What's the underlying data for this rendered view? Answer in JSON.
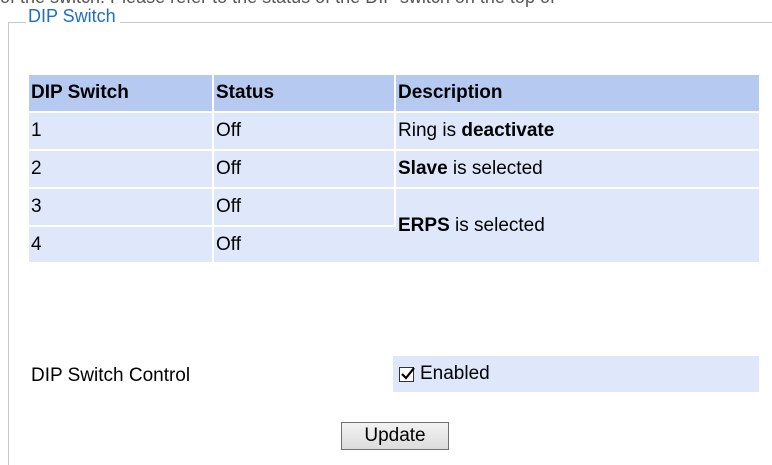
{
  "top_clipped_text": "of the switch. Please refer to the status of the DIP switch on the top of",
  "panel": {
    "legend": "DIP Switch"
  },
  "table": {
    "headers": {
      "dip_switch": "DIP Switch",
      "status": "Status",
      "description": "Description"
    },
    "rows": [
      {
        "dip": "1",
        "status": "Off"
      },
      {
        "dip": "2",
        "status": "Off"
      },
      {
        "dip": "3",
        "status": "Off"
      },
      {
        "dip": "4",
        "status": "Off"
      }
    ],
    "descriptions": {
      "ring_prefix": "Ring is ",
      "ring_bold": "deactivate",
      "slave_bold": "Slave",
      "slave_suffix": " is selected",
      "erps_bold": "ERPS",
      "erps_suffix": " is selected"
    }
  },
  "control": {
    "label": "DIP Switch Control",
    "checkbox_checked": true,
    "checkbox_label": "Enabled"
  },
  "update_button": "Update"
}
